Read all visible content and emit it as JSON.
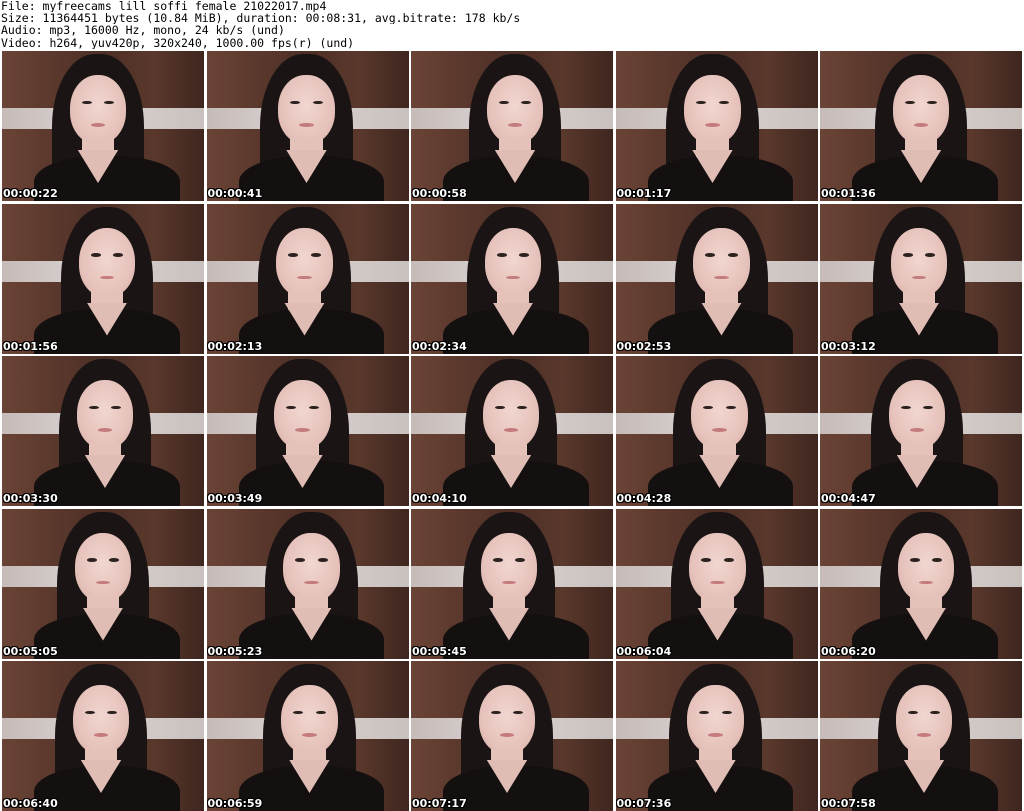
{
  "header": {
    "file": "File: myfreecams_lill_soffi_female_21022017.mp4",
    "size": "Size: 11364451 bytes (10.84 MiB), duration: 00:08:31, avg.bitrate: 178 kb/s",
    "audio": "Audio: mp3, 16000 Hz, mono, 24 kb/s (und)",
    "video": "Video: h264, yuv420p, 320x240, 1000.00 fps(r) (und)"
  },
  "thumbnails": [
    "00:00:22",
    "00:00:41",
    "00:00:58",
    "00:01:17",
    "00:01:36",
    "00:01:56",
    "00:02:13",
    "00:02:34",
    "00:02:53",
    "00:03:12",
    "00:03:30",
    "00:03:49",
    "00:04:10",
    "00:04:28",
    "00:04:47",
    "00:05:05",
    "00:05:23",
    "00:05:45",
    "00:06:04",
    "00:06:20",
    "00:06:40",
    "00:06:59",
    "00:07:17",
    "00:07:36",
    "00:07:58"
  ]
}
